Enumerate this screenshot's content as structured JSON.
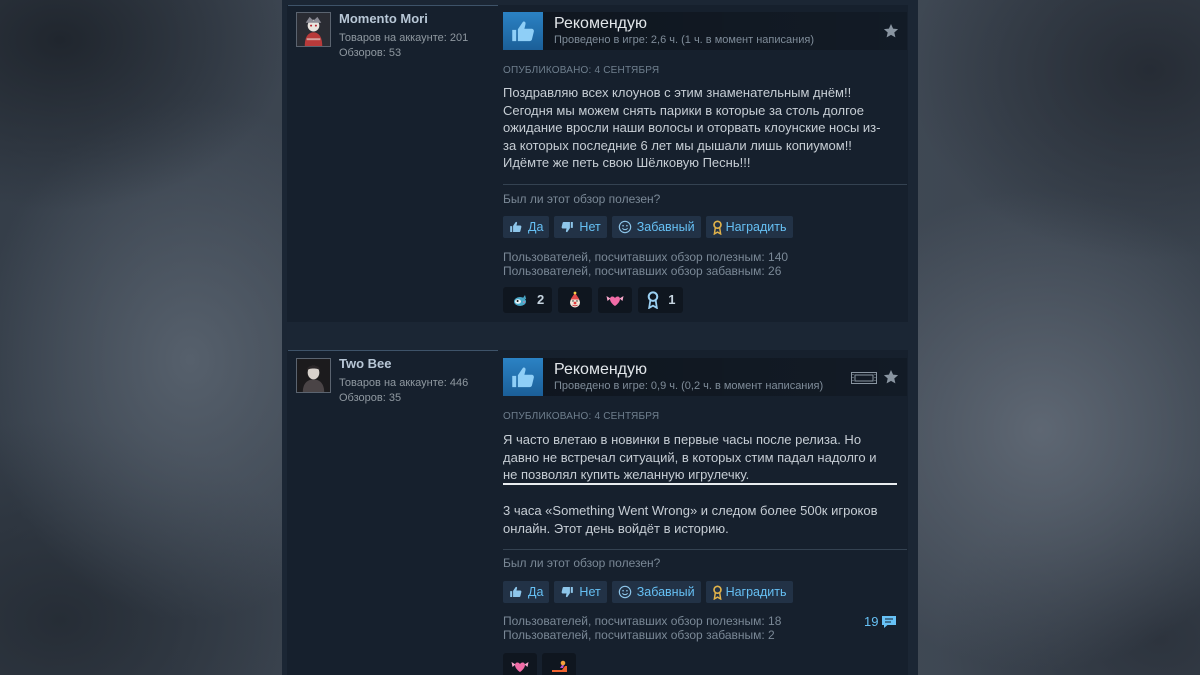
{
  "colors": {
    "accent": "#66c0f4",
    "card_background": "#16202d",
    "award_gold": "#e2b34a"
  },
  "reviews": [
    {
      "author": {
        "name": "Momento Mori",
        "products": "Товаров на аккаунте: 201",
        "review_count": "Обзоров: 53",
        "avatar_icon": "avatar-image"
      },
      "verdict": "Рекомендую",
      "verdict_icon": "thumbs-up-icon",
      "playtime": "Проведено в игре: 2,6 ч. (1 ч. в момент написания)",
      "header_icons": [
        "star-icon"
      ],
      "posted": "ОПУБЛИКОВАНО: 4 СЕНТЯБРЯ",
      "paragraphs": [
        [
          "Поздравляю всех клоунов с этим знаменательным днём!!",
          "Сегодня мы можем снять парики в которые за столь долгое",
          "ожидание вросли наши волосы и оторвать клоунские носы из-",
          "за которых последние 6 лет мы дышали лишь копиумом!!",
          "Идёмте же петь свою Шёлковую Песнь!!!"
        ]
      ],
      "helpful_question": "Был ли этот обзор полезен?",
      "vote_buttons": [
        {
          "label": "Да",
          "icon": "thumbs-up-icon"
        },
        {
          "label": "Нет",
          "icon": "thumbs-down-icon"
        },
        {
          "label": "Забавный",
          "icon": "smiley-icon"
        },
        {
          "label": "Наградить",
          "icon": "award-icon"
        }
      ],
      "stats": [
        "Пользователей, посчитавших обзор полезным: 140",
        "Пользователей, посчитавших обзор забавным: 26"
      ],
      "reactions": [
        {
          "icon": "teal-creature-icon",
          "count": "2"
        },
        {
          "icon": "clown-face-icon"
        },
        {
          "icon": "winged-heart-icon"
        },
        {
          "icon": "award-ribbon-icon",
          "count": "1"
        }
      ]
    },
    {
      "author": {
        "name": "Two Bee",
        "products": "Товаров на аккаунте: 446",
        "review_count": "Обзоров: 35",
        "avatar_icon": "avatar-image"
      },
      "verdict": "Рекомендую",
      "verdict_icon": "thumbs-up-icon",
      "playtime": "Проведено в игре: 0,9 ч. (0,2 ч. в момент написания)",
      "header_icons": [
        "video-icon",
        "star-icon"
      ],
      "posted": "ОПУБЛИКОВАНО: 4 СЕНТЯБРЯ",
      "paragraphs": [
        [
          "Я часто влетаю в новинки в первые часы после релиза. Но",
          "давно не встречал ситуаций, в которых стим падал надолго и",
          "не позволял купить желанную игрулечку."
        ],
        [
          "3 часа «Something Went Wrong» и следом более 500к игроков",
          "онлайн. Этот день войдёт в историю."
        ]
      ],
      "helpful_question": "Был ли этот обзор полезен?",
      "vote_buttons": [
        {
          "label": "Да",
          "icon": "thumbs-up-icon"
        },
        {
          "label": "Нет",
          "icon": "thumbs-down-icon"
        },
        {
          "label": "Забавный",
          "icon": "smiley-icon"
        },
        {
          "label": "Наградить",
          "icon": "award-icon"
        }
      ],
      "stats": [
        "Пользователей, посчитавших обзор полезным: 18",
        "Пользователей, посчитавших обзор забавным: 2"
      ],
      "comment_count": "19",
      "reactions": [
        {
          "icon": "winged-heart-icon"
        },
        {
          "icon": "sneaker-icon"
        }
      ]
    }
  ]
}
